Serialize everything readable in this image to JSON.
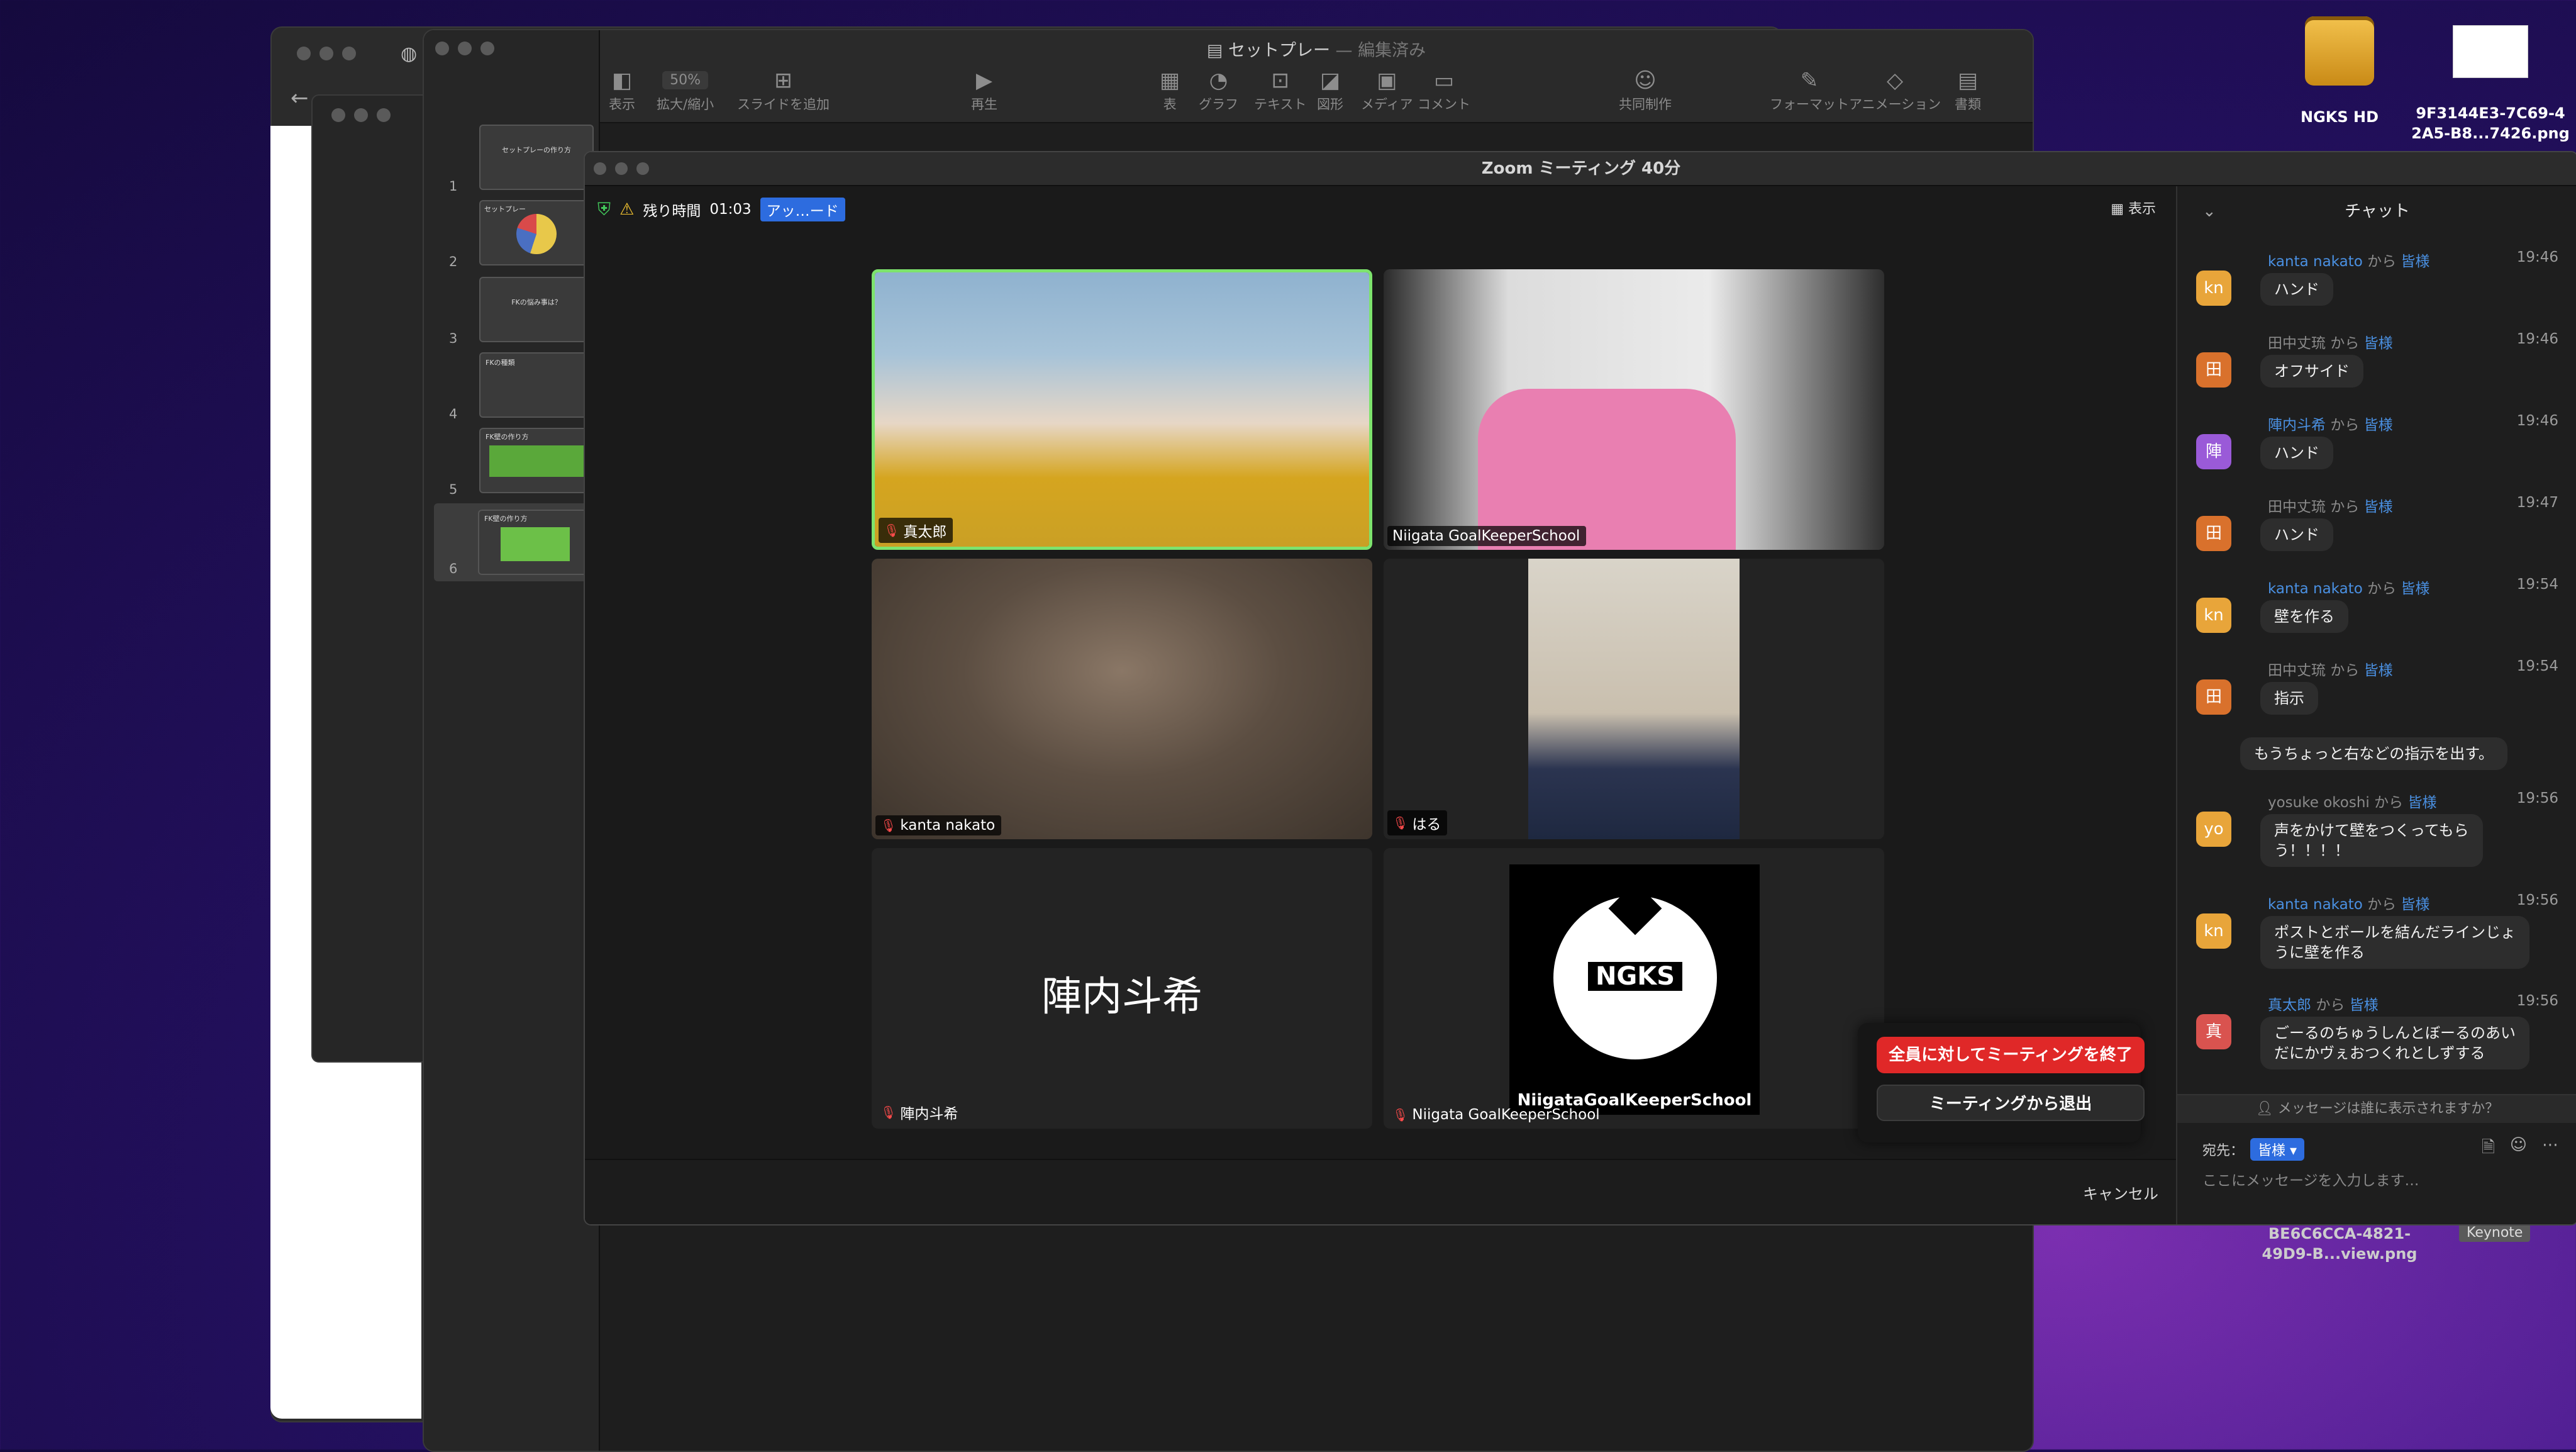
{
  "desktop": {
    "icons": [
      {
        "name": "hd-icon",
        "label": "NGKS HD"
      },
      {
        "name": "png-file-icon",
        "label_line1": "9F3144E3-7C69-4",
        "label_line2": "2A5-B8...7426.png"
      },
      {
        "name": "png-file-icon-2",
        "label_line1": "BE6C6CCA-4821-",
        "label_line2": "49D9-B...view.png"
      }
    ],
    "keynote_tag": "Keynote"
  },
  "keynote": {
    "title": "セットプレー",
    "title_suffix": "— 編集済み",
    "toolbar": [
      {
        "icon": "sidebar-view-icon",
        "label": "表示"
      },
      {
        "icon": "zoom-select-icon",
        "label": "拡大/縮小",
        "value": "50%"
      },
      {
        "icon": "add-slide-icon",
        "label": "スライドを追加"
      },
      {
        "icon": "play-icon",
        "label": "再生"
      },
      {
        "icon": "table-icon",
        "label": "表"
      },
      {
        "icon": "chart-icon",
        "label": "グラフ"
      },
      {
        "icon": "text-icon",
        "label": "テキスト"
      },
      {
        "icon": "shape-icon",
        "label": "図形"
      },
      {
        "icon": "media-icon",
        "label": "メディア"
      },
      {
        "icon": "comment-icon",
        "label": "コメント"
      },
      {
        "icon": "collaborate-icon",
        "label": "共同制作"
      },
      {
        "icon": "format-icon",
        "label": "フォーマット"
      },
      {
        "icon": "animate-icon",
        "label": "アニメーション"
      },
      {
        "icon": "document-icon",
        "label": "書類"
      }
    ],
    "slides": [
      {
        "num": "1",
        "title": "セットプレーの作り方"
      },
      {
        "num": "2",
        "title": "セットプレー"
      },
      {
        "num": "3",
        "title": "FKの悩み事は？"
      },
      {
        "num": "4",
        "title": "FKの種類"
      },
      {
        "num": "5",
        "title": "FK壁の作り方"
      },
      {
        "num": "6",
        "title": "FK壁の作り方"
      }
    ]
  },
  "zoom": {
    "window_title": "Zoom ミーティング 40分",
    "time_left_label": "残り時間",
    "time_left": "01:03",
    "upgrade_badge": "アッ…ード",
    "view_label": "表示",
    "participants": [
      {
        "name": "真太郎",
        "active": true
      },
      {
        "name": "Niigata GoalKeeperSchool"
      },
      {
        "name": "kanta nakato"
      },
      {
        "name": "はる"
      },
      {
        "name": "陣内斗希",
        "display": "陣内斗希"
      },
      {
        "name": "Niigata GoalKeeperSchool"
      }
    ],
    "logo_text": "NGKS",
    "logo_ring_text": "NiigataGoalKeeperSchool",
    "end_for_all": "全員に対してミーティングを終了",
    "leave": "ミーティングから退出",
    "cancel": "キャンセル"
  },
  "chat": {
    "title": "チャット",
    "from_word": "から",
    "to_word": "皆様",
    "messages": [
      {
        "avatar": "kn",
        "color": "#e8a53a",
        "sender": "kanta nakato",
        "time": "19:46",
        "text": "ハンド"
      },
      {
        "avatar": "田",
        "color": "#d9712c",
        "sender": "田中丈琉",
        "time": "19:46",
        "text": "オフサイド"
      },
      {
        "avatar": "陣",
        "color": "#9a5ad8",
        "sender": "陣内斗希",
        "time": "19:46",
        "text": "ハンド"
      },
      {
        "avatar": "田",
        "color": "#d9712c",
        "sender": "田中丈琉",
        "time": "19:47",
        "text": "ハンド"
      },
      {
        "avatar": "kn",
        "color": "#e8a53a",
        "sender": "kanta nakato",
        "time": "19:54",
        "text": "壁を作る"
      },
      {
        "avatar": "田",
        "color": "#d9712c",
        "sender": "田中丈琉",
        "time": "19:54",
        "text": "指示"
      },
      {
        "text": "もうちょっと右などの指示を出す。"
      },
      {
        "avatar": "yo",
        "color": "#e8a53a",
        "sender": "yosuke okoshi",
        "time": "19:56",
        "text1": "声をかけて壁をつくってもら",
        "text2": "う！！！！"
      },
      {
        "avatar": "kn",
        "color": "#e8a53a",
        "sender": "kanta nakato",
        "time": "19:56",
        "text1": "ポストとボールを結んだラインじょ",
        "text2": "うに壁を作る"
      },
      {
        "avatar": "真",
        "color": "#d9534f",
        "sender": "真太郎",
        "time": "19:56",
        "text1": "ごーるのちゅうしんとぼーるのあい",
        "text2": "だにかヴぇおつくれとしずする"
      }
    ],
    "who_can_see": "メッセージは誰に表示されますか？",
    "to_label": "宛先：",
    "to_value": "皆様",
    "input_placeholder": "ここにメッセージを入力します…"
  }
}
